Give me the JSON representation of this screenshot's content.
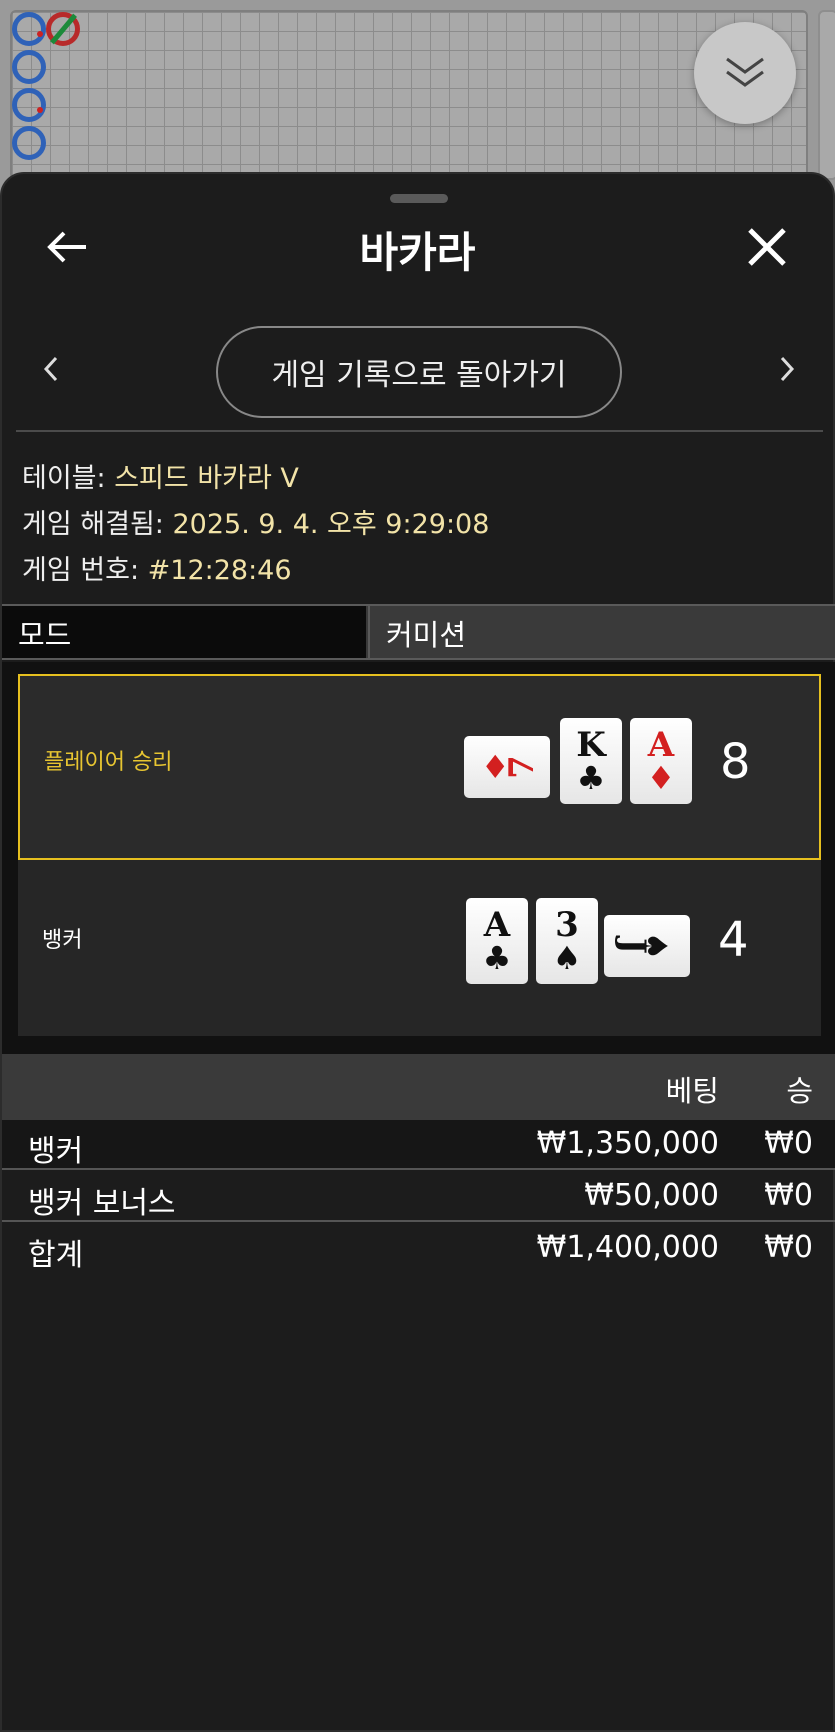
{
  "sheet": {
    "title": "바카라",
    "back_button": "back-arrow-icon",
    "close_button": "close-icon",
    "history_button_label": "게임 기록으로 돌아가기"
  },
  "info": {
    "table_label": "테이블:",
    "table_value": "스피드 바카라 V",
    "resolved_label": "게임 해결됨:",
    "resolved_value": "2025. 9. 4. 오후 9:29:08",
    "game_no_label": "게임 번호:",
    "game_no_value": "#12:28:46"
  },
  "mode": {
    "mode_label": "모드",
    "mode_value": "커미션"
  },
  "results": {
    "player": {
      "label": "플레이어 승리",
      "score": "8",
      "cards": [
        {
          "rank": "7",
          "suit": "♦",
          "color": "#d32020",
          "orientation": "horizontal"
        },
        {
          "rank": "K",
          "suit": "♣",
          "color": "#111111",
          "orientation": "vertical"
        },
        {
          "rank": "A",
          "suit": "♦",
          "color": "#d32020",
          "orientation": "vertical"
        }
      ]
    },
    "banker": {
      "label": "뱅커",
      "score": "4",
      "cards": [
        {
          "rank": "A",
          "suit": "♣",
          "color": "#111111",
          "orientation": "vertical"
        },
        {
          "rank": "3",
          "suit": "♠",
          "color": "#111111",
          "orientation": "vertical"
        },
        {
          "rank": "J",
          "suit": "♠",
          "color": "#111111",
          "orientation": "horizontal"
        }
      ]
    }
  },
  "bets": {
    "header_bet": "베팅",
    "header_win": "승",
    "rows": [
      {
        "name": "뱅커",
        "amount": "₩1,350,000",
        "win": "₩0"
      },
      {
        "name": "뱅커 보너스",
        "amount": "₩50,000",
        "win": "₩0"
      }
    ],
    "total": {
      "name": "합계",
      "amount": "₩1,400,000",
      "win": "₩0"
    }
  },
  "colors": {
    "accent_win": "#e6c01f",
    "value_text": "#f2e3a8",
    "card_red": "#d32020"
  }
}
